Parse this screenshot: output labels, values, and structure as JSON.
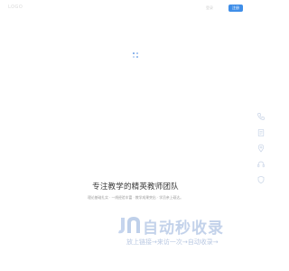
{
  "header": {
    "logo_text": "LOGO",
    "login_label": "登录",
    "register_label": "注册"
  },
  "hero": {
    "title": "专注教学的精英教师团队",
    "subtitle": "理论基础扎实 · 一线经验丰富 · 教学成果突出 · 学员亲上硕达。"
  },
  "sidebar": {
    "icons": [
      "phone-icon",
      "document-icon",
      "location-icon",
      "headset-icon",
      "shield-icon"
    ],
    "color": "#c7d3e6"
  },
  "watermark": {
    "title": "自动秒收录",
    "subtitle": "放上链接→来访一次→自动收录→",
    "color": "#c3d2ea"
  },
  "colors": {
    "accent": "#3f8ee8"
  }
}
